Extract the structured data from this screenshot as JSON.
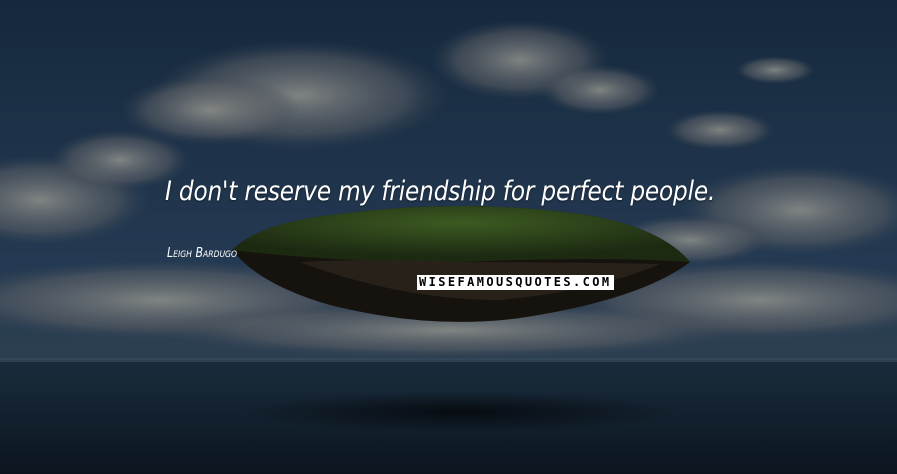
{
  "quote": {
    "text": "I don't reserve my friendship for perfect people."
  },
  "author": {
    "name": "Leigh Bardugo"
  },
  "watermark": {
    "text": "WISEFAMOUSQUOTES.COM"
  },
  "colors": {
    "sky": "#1a2e45",
    "sea": "#0f1e2c",
    "text": "#ffffff"
  }
}
